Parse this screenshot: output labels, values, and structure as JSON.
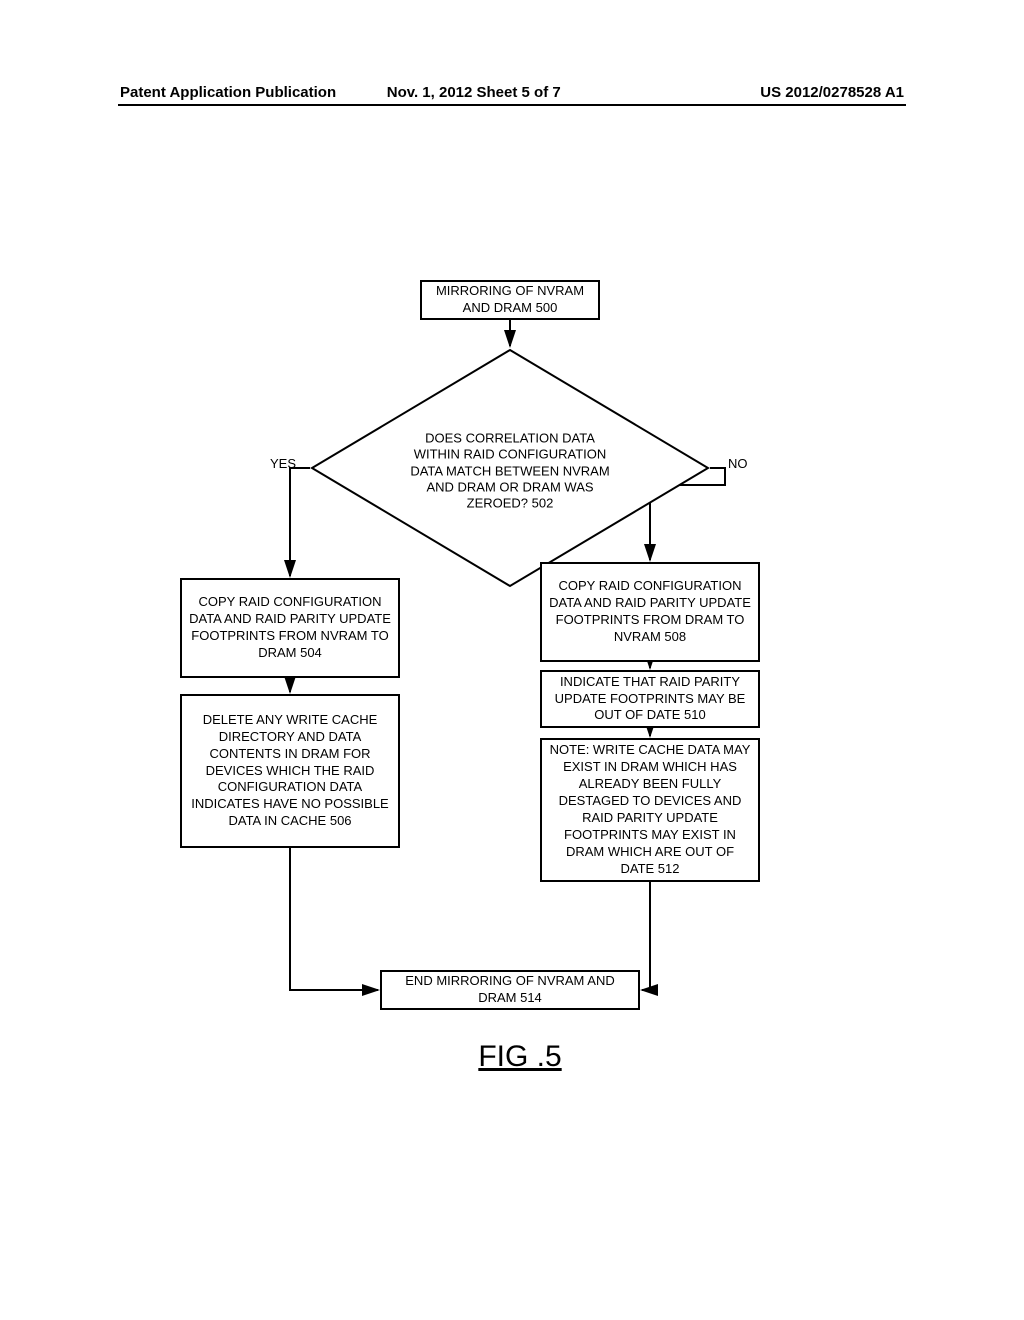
{
  "header": {
    "left": "Patent Application Publication",
    "center": "Nov. 1, 2012  Sheet 5 of 7",
    "right": "US 2012/0278528 A1"
  },
  "flowchart": {
    "start": "MIRRORING OF NVRAM AND DRAM 500",
    "decision": "DOES CORRELATION DATA WITHIN RAID CONFIGURATION DATA MATCH BETWEEN NVRAM AND DRAM OR DRAM WAS ZEROED? 502",
    "yes_label": "YES",
    "no_label": "NO",
    "box504": "COPY RAID CONFIGURATION DATA AND RAID PARITY UPDATE FOOTPRINTS FROM NVRAM TO DRAM 504",
    "box506": "DELETE ANY WRITE CACHE DIRECTORY AND DATA CONTENTS IN DRAM FOR DEVICES WHICH THE RAID CONFIGURATION DATA INDICATES HAVE NO POSSIBLE DATA IN CACHE 506",
    "box508": "COPY RAID CONFIGURATION DATA AND RAID PARITY UPDATE FOOTPRINTS FROM DRAM TO NVRAM 508",
    "box510": "INDICATE THAT RAID PARITY UPDATE FOOTPRINTS MAY BE OUT OF DATE 510",
    "box512": "NOTE: WRITE CACHE DATA MAY EXIST IN DRAM WHICH HAS ALREADY BEEN FULLY DESTAGED TO DEVICES AND RAID PARITY UPDATE FOOTPRINTS MAY EXIST IN DRAM WHICH ARE OUT OF DATE 512",
    "end": "END MIRRORING OF NVRAM AND DRAM 514",
    "figure_label": "FIG .5"
  }
}
